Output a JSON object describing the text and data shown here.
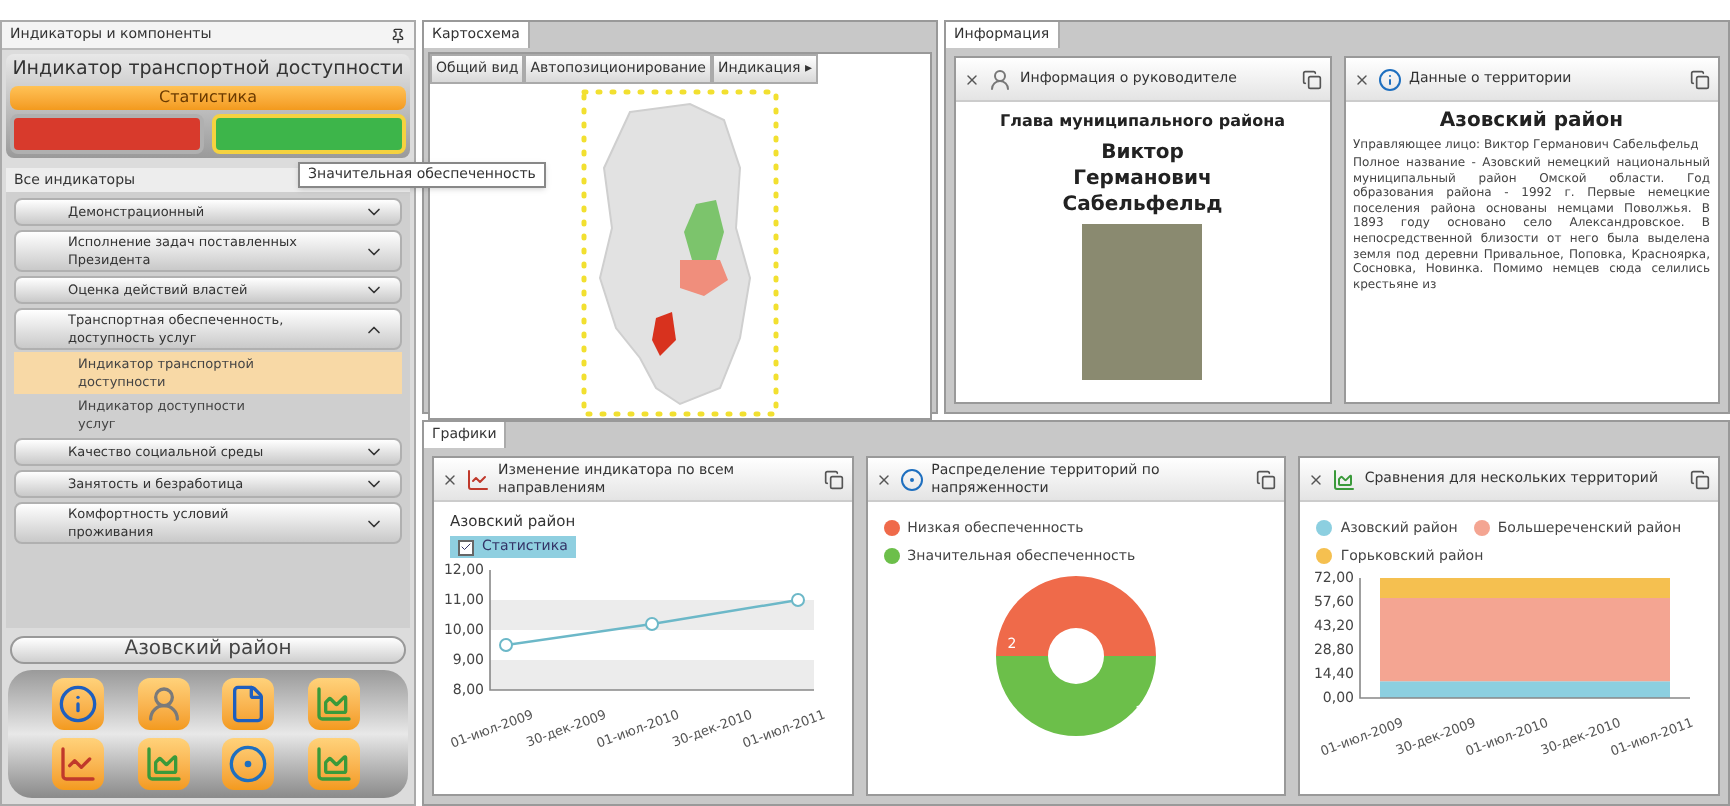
{
  "left_panel": {
    "title": "Индикаторы и компоненты",
    "indicator": {
      "title": "Индикатор транспортной доступности",
      "mode": "Статистика",
      "bars": [
        {
          "color": "#d83a2c",
          "selected": false
        },
        {
          "color": "#3db54a",
          "selected": true
        }
      ]
    },
    "tooltip": "Значительная обеспеченность",
    "tree": {
      "label": "Все индикаторы",
      "expanded": true,
      "children": [
        {
          "label": "Демонстрационный",
          "expanded": false
        },
        {
          "label": "Исполнение задач поставленных Президента",
          "expanded": false
        },
        {
          "label": "Оценка действий властей",
          "expanded": false
        },
        {
          "label": "Транспортная обеспеченность, доступность услуг",
          "expanded": true,
          "children": [
            {
              "label": "Индикатор транспортной доступности",
              "selected": true
            },
            {
              "label": "Индикатор доступности услуг",
              "selected": false
            }
          ]
        },
        {
          "label": "Качество социальной среды",
          "expanded": false
        },
        {
          "label": "Занятость и безработица",
          "expanded": false
        },
        {
          "label": "Комфортность условий проживания",
          "expanded": false
        }
      ]
    },
    "district": "Азовский район",
    "tools": [
      {
        "kind": "info"
      },
      {
        "kind": "person"
      },
      {
        "kind": "document"
      },
      {
        "kind": "area"
      },
      {
        "kind": "line"
      },
      {
        "kind": "area"
      },
      {
        "kind": "donut"
      },
      {
        "kind": "area"
      }
    ]
  },
  "map_panel": {
    "tab": "Картосхема",
    "toolbar": [
      "Общий вид",
      "Автопозиционирование",
      "Индикация ▸"
    ]
  },
  "info_panel": {
    "tab": "Информация",
    "head_card": {
      "title": "Информация о руководителе",
      "role": "Глава муниципального района",
      "name": "Виктор Германович Сабельфельд"
    },
    "territory_card": {
      "title": "Данные о территории",
      "heading": "Азовский район",
      "manager": "Управляющее лицо: Виктор Германович Сабельфельд",
      "description": "Полное название - Азовский немецкий национальный муниципальный район Омской области. Год образования района - 1992 г. Первые немецкие поселения района основаны немцами Поволжья. В 1893 году основано село Александровское. В непосредственной близости от него была выделена земля под деревни Привальное, Поповка, Красноярка, Сосновка, Новинка. Помимо немцев сюда селились крестьяне из"
    }
  },
  "charts_panel": {
    "tab": "Графики",
    "line_card": {
      "title": "Изменение индикатора по всем направлениям",
      "district": "Азовский район",
      "series_toggle": {
        "checked": true
      },
      "chart_data": {
        "type": "line",
        "x": [
          "01-июл-2009",
          "30-дек-2009",
          "01-июл-2010",
          "30-дек-2010",
          "01-июл-2011"
        ],
        "series": [
          {
            "name": "Статистика",
            "color": "#6cb8c8",
            "marker": "circle",
            "values": [
              9.5,
              null,
              10.2,
              null,
              11.0
            ]
          }
        ],
        "ylim": [
          8,
          12
        ],
        "yticks": [
          {
            "value": 8,
            "label": "8,00"
          },
          {
            "value": 9,
            "label": "9,00"
          },
          {
            "value": 10,
            "label": "10,00"
          },
          {
            "value": 11,
            "label": "11,00"
          },
          {
            "value": 12,
            "label": "12,00"
          }
        ]
      }
    },
    "donut_card": {
      "title": "Распределение территорий по напряженности",
      "chart_data": {
        "type": "donut",
        "categories": [
          "Низкая обеспеченность",
          "Значительная обеспеченность"
        ],
        "series": [
          {
            "values": [
              2,
              2
            ]
          }
        ],
        "colors": [
          "#ef6a4a",
          "#6cbf4a"
        ],
        "data_labels": true
      }
    },
    "area_card": {
      "title": "Сравнения для нескольких территорий",
      "chart_data": {
        "type": "area",
        "stacked": true,
        "x": [
          "01-июл-2009",
          "30-дек-2009",
          "01-июл-2010",
          "30-дек-2010",
          "01-июл-2011"
        ],
        "series": [
          {
            "name": "Азовский район",
            "color": "#8ccfe0",
            "values": [
              10,
              null,
              10,
              null,
              10
            ]
          },
          {
            "name": "Большереченский район",
            "color": "#f4a592",
            "values": [
              50,
              null,
              50,
              null,
              50
            ]
          },
          {
            "name": "Горьковский район",
            "color": "#f5c050",
            "values": [
              12,
              null,
              12,
              null,
              12
            ]
          }
        ],
        "ylim": [
          0,
          72
        ],
        "yticks": [
          {
            "value": 0,
            "label": "0,00"
          },
          {
            "value": 14.4,
            "label": "14,40"
          },
          {
            "value": 28.8,
            "label": "28,80"
          },
          {
            "value": 43.2,
            "label": "43,20"
          },
          {
            "value": 57.6,
            "label": "57,60"
          },
          {
            "value": 72,
            "label": "72,00"
          }
        ]
      }
    }
  }
}
